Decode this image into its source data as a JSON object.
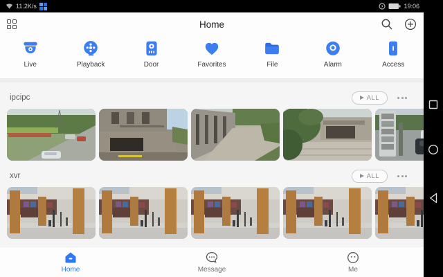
{
  "status_bar": {
    "network_speed": "11.2K/s",
    "time": "19:06"
  },
  "header": {
    "title": "Home"
  },
  "shortcuts": [
    {
      "label": "Live",
      "icon": "dome-camera-icon"
    },
    {
      "label": "Playback",
      "icon": "playback-reel-icon"
    },
    {
      "label": "Door",
      "icon": "door-intercom-icon"
    },
    {
      "label": "Favorites",
      "icon": "heart-icon"
    },
    {
      "label": "File",
      "icon": "folder-icon"
    },
    {
      "label": "Alarm",
      "icon": "alarm-siren-icon"
    },
    {
      "label": "Access",
      "icon": "access-control-icon"
    }
  ],
  "sections": [
    {
      "name": "ipcipc",
      "play_all_label": "ALL",
      "cameras": [
        "street-view",
        "concrete-building",
        "walkway",
        "entrance",
        "parking-lot"
      ]
    },
    {
      "name": "xvr",
      "play_all_label": "ALL",
      "cameras": [
        "library-interior",
        "library-interior",
        "library-interior",
        "library-interior",
        "library-interior"
      ]
    }
  ],
  "bottom_nav": [
    {
      "label": "Home",
      "active": true
    },
    {
      "label": "Message",
      "active": false
    },
    {
      "label": "Me",
      "active": false
    }
  ],
  "colors": {
    "accent": "#3c7ef2",
    "accent_dark": "#2d6fe0",
    "nav_active": "#2f78f5"
  }
}
